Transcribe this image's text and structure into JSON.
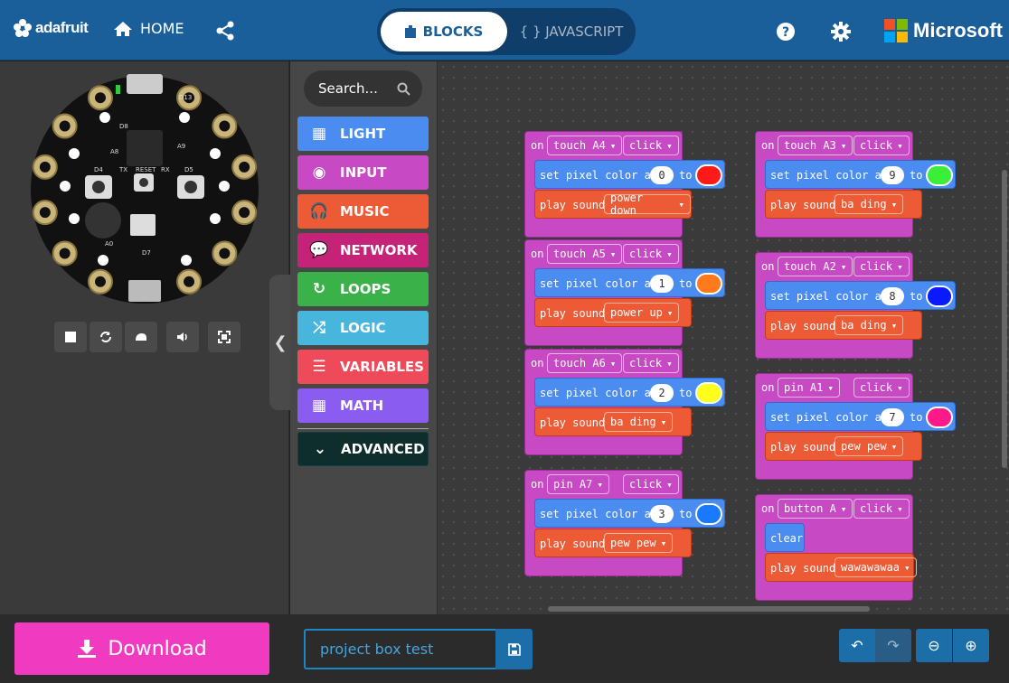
{
  "header": {
    "brand": "adafruit",
    "home_label": "HOME",
    "tabs": {
      "blocks": "BLOCKS",
      "javascript": "{ } JAVASCRIPT"
    },
    "microsoft": "Microsoft"
  },
  "simulator": {
    "controls": [
      "stop-icon",
      "restart-icon",
      "slow-motion-icon",
      "sound-icon",
      "fullscreen-icon"
    ]
  },
  "toolbox": {
    "search_placeholder": "Search...",
    "categories": [
      {
        "label": "LIGHT",
        "color": "#4a8cf0",
        "icon": "grid-icon"
      },
      {
        "label": "INPUT",
        "color": "#c74ac4",
        "icon": "target-icon"
      },
      {
        "label": "MUSIC",
        "color": "#ec5a36",
        "icon": "headphones-icon"
      },
      {
        "label": "NETWORK",
        "color": "#c52378",
        "icon": "chat-icon"
      },
      {
        "label": "LOOPS",
        "color": "#3bb14a",
        "icon": "refresh-icon"
      },
      {
        "label": "LOGIC",
        "color": "#48b5dc",
        "icon": "shuffle-icon"
      },
      {
        "label": "VARIABLES",
        "color": "#ee4a5a",
        "icon": "lines-icon"
      },
      {
        "label": "MATH",
        "color": "#8b5cf0",
        "icon": "calculator-icon"
      }
    ],
    "advanced": "ADVANCED"
  },
  "workspace": {
    "on": "on",
    "set_pixel": "set pixel color at",
    "to": "to",
    "play_sound": "play sound",
    "clear": "clear",
    "blocks": [
      {
        "trigger": "touch A4",
        "event": "click",
        "pixel": "0",
        "color": "#ff1a1a",
        "sound": "power down"
      },
      {
        "trigger": "touch A5",
        "event": "click",
        "pixel": "1",
        "color": "#ff7a1a",
        "sound": "power up"
      },
      {
        "trigger": "touch A6",
        "event": "click",
        "pixel": "2",
        "color": "#ffff1a",
        "sound": "ba ding"
      },
      {
        "trigger": "pin A7",
        "event": "click",
        "pixel": "3",
        "color": "#1a7aff",
        "sound": "pew pew"
      },
      {
        "trigger": "touch A3",
        "event": "click",
        "pixel": "9",
        "color": "#3aee3a",
        "sound": "ba ding"
      },
      {
        "trigger": "touch A2",
        "event": "click",
        "pixel": "8",
        "color": "#0a1aff",
        "sound": "ba ding"
      },
      {
        "trigger": "pin A1",
        "event": "click",
        "pixel": "7",
        "color": "#ff1a8a",
        "sound": "pew pew"
      }
    ],
    "button_block": {
      "trigger": "button A",
      "event": "click",
      "sound": "wawawawaa"
    }
  },
  "bottom": {
    "download_label": "Download",
    "project_name": "project box test"
  },
  "colors": {
    "header": "#1a5e9a",
    "download": "#f03ac0",
    "accent": "#1b87c5"
  }
}
